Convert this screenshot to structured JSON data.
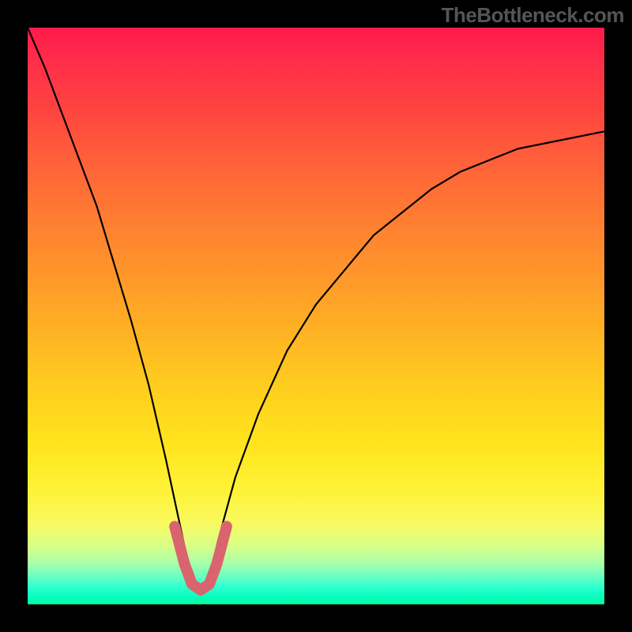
{
  "attribution": "TheBottleneck.com",
  "chart_data": {
    "type": "line",
    "title": "",
    "xlabel": "",
    "ylabel": "",
    "xlim": [
      0,
      1
    ],
    "ylim": [
      0,
      1
    ],
    "background_gradient_meaning": "red at top (high bottleneck) to green at bottom (no bottleneck)",
    "series": [
      {
        "name": "bottleneck-curve",
        "x": [
          0.0,
          0.03,
          0.06,
          0.09,
          0.12,
          0.15,
          0.18,
          0.21,
          0.24,
          0.27,
          0.285,
          0.3,
          0.315,
          0.33,
          0.36,
          0.4,
          0.45,
          0.5,
          0.55,
          0.6,
          0.65,
          0.7,
          0.75,
          0.8,
          0.85,
          0.9,
          0.95,
          1.0
        ],
        "y": [
          1.0,
          0.93,
          0.85,
          0.77,
          0.69,
          0.59,
          0.49,
          0.38,
          0.25,
          0.11,
          0.04,
          0.02,
          0.04,
          0.11,
          0.22,
          0.33,
          0.44,
          0.52,
          0.58,
          0.64,
          0.68,
          0.72,
          0.75,
          0.77,
          0.79,
          0.8,
          0.81,
          0.82
        ]
      },
      {
        "name": "highlight-range",
        "description": "Thick red segment near curve minimum",
        "x": [
          0.255,
          0.272,
          0.285,
          0.3,
          0.315,
          0.328,
          0.345
        ],
        "y": [
          0.135,
          0.07,
          0.035,
          0.025,
          0.035,
          0.07,
          0.135
        ]
      }
    ]
  }
}
